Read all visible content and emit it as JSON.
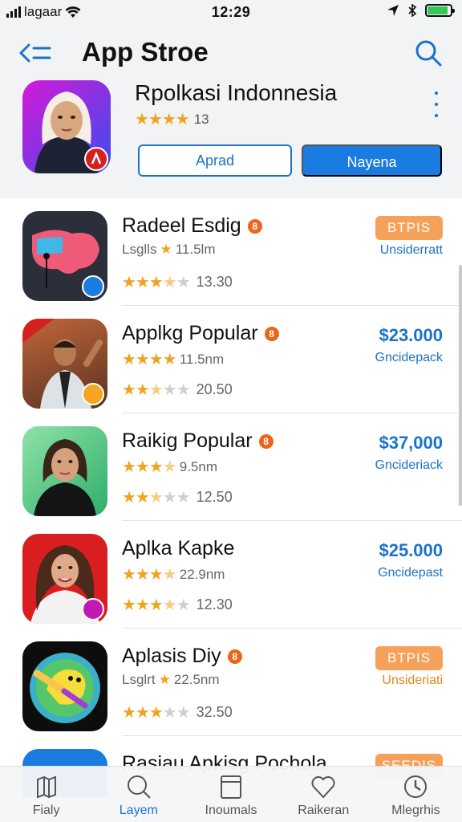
{
  "status": {
    "carrier": "lagaar",
    "time": "12:29"
  },
  "header": {
    "title": "App Stroe",
    "featured": {
      "title": "Rpolkasi Indonnesia",
      "rating_count": "13",
      "button_outline": "Aprad",
      "button_primary": "Nayena"
    }
  },
  "apps": [
    {
      "name": "Radeel Esdig",
      "sub": "Lsglls",
      "size": "11.5lm",
      "stars": 3.5,
      "rating": "13.30",
      "badge": "BTPIS",
      "note": "Unsiderratt",
      "pill": true,
      "pill_color": "#f5a15a"
    },
    {
      "name": "Applkg Popular",
      "sub": "",
      "size": "11.5nm",
      "stars": 2.5,
      "rating": "20.50",
      "price": "$23.000",
      "note": "Gncidepack"
    },
    {
      "name": "Raikig Popular",
      "sub": "",
      "size": "9.5nm",
      "stars": 2.5,
      "rating": "12.50",
      "price": "$37,000",
      "note": "Gncideriack"
    },
    {
      "name": "Aplka Kapke",
      "sub": "",
      "size": "22.9nm",
      "stars": 3.5,
      "rating": "12.30",
      "price": "$25.000",
      "note": "Gncidepast"
    },
    {
      "name": "Aplasis Diy",
      "sub": "Lsglrt",
      "size": "22.5nm",
      "stars": 3,
      "rating": "32.50",
      "badge": "BTPIS",
      "note": "Unsideriati",
      "pill": true
    }
  ],
  "partial_row": {
    "name": "Rasiau Apkisg Pochola",
    "badge": "SEEDIS"
  },
  "tabs": [
    {
      "label": "Fialy",
      "icon": "map-icon"
    },
    {
      "label": "Layem",
      "icon": "search-icon",
      "active": true
    },
    {
      "label": "Inoumals",
      "icon": "document-icon"
    },
    {
      "label": "Raikeran",
      "icon": "heart-icon"
    },
    {
      "label": "Mlegrhis",
      "icon": "clock-icon"
    }
  ],
  "colors": {
    "accent": "#1a73c8",
    "star": "#f0a31e",
    "pill": "#f5a15a"
  }
}
